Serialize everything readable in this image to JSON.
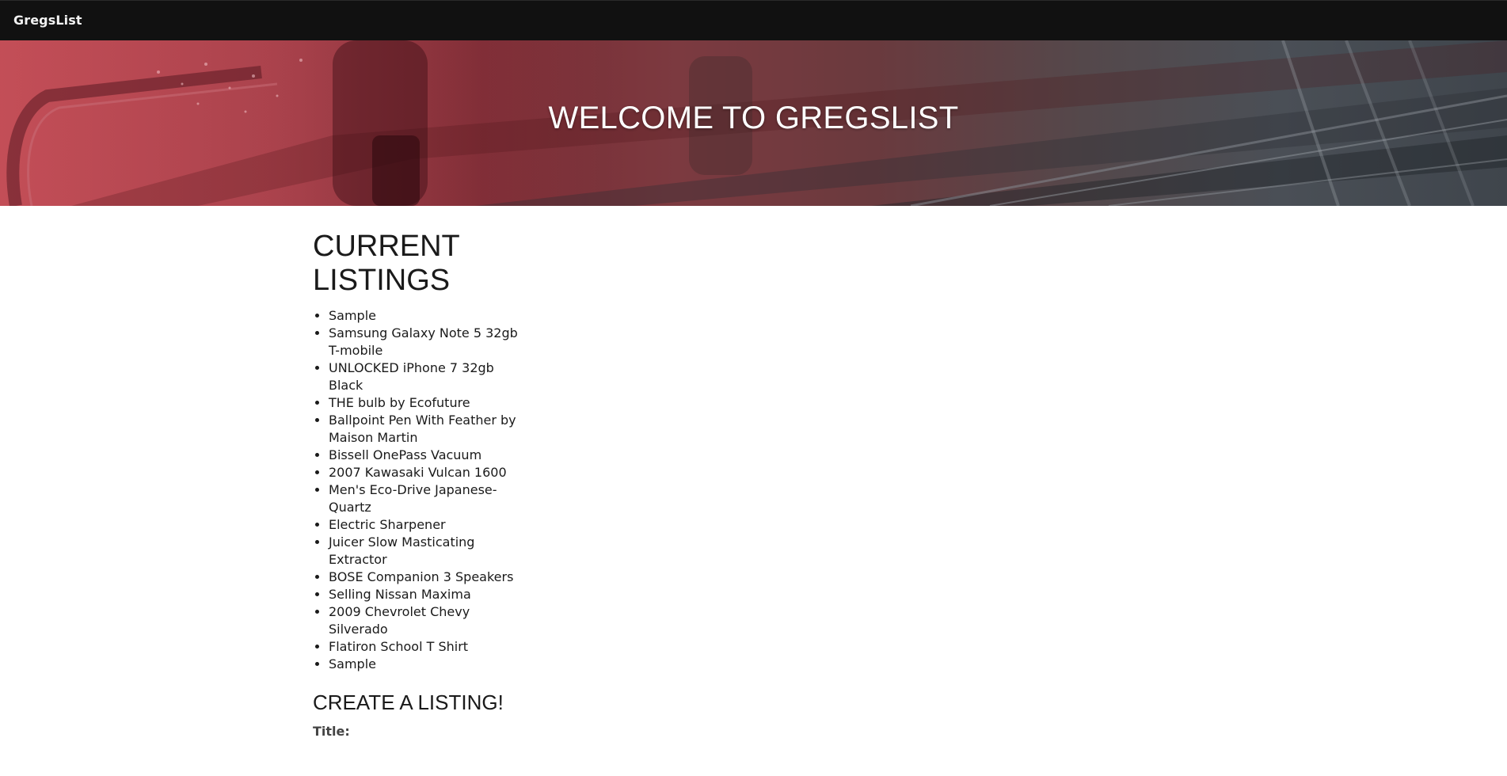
{
  "navbar": {
    "brand": "GregsList"
  },
  "hero": {
    "title": "WELCOME TO GREGSLIST"
  },
  "listings": {
    "title": "CURRENT LISTINGS",
    "items": [
      "Sample",
      "Samsung Galaxy Note 5 32gb T-mobile",
      "UNLOCKED iPhone 7 32gb Black",
      "THE bulb by Ecofuture",
      "Ballpoint Pen With Feather by Maison Martin",
      "Bissell OnePass Vacuum",
      "2007 Kawasaki Vulcan 1600",
      "Men's Eco-Drive Japanese-Quartz",
      "Electric Sharpener",
      "Juicer Slow Masticating Extractor",
      "BOSE Companion 3 Speakers",
      "Selling Nissan Maxima",
      "2009 Chevrolet Chevy Silverado",
      "Flatiron School T Shirt",
      "Sample"
    ]
  },
  "create": {
    "title": "CREATE A LISTING!",
    "title_label": "Title:"
  }
}
